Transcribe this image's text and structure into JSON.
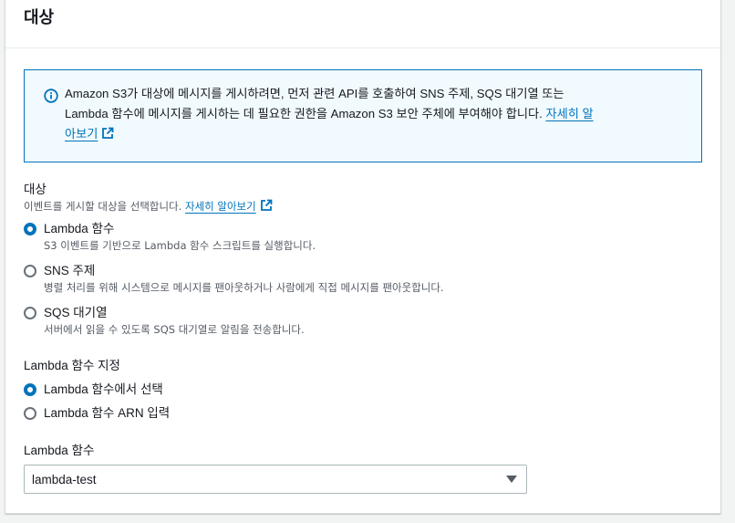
{
  "panel": {
    "title": "대상"
  },
  "alert": {
    "icon": "info-icon",
    "line1": "Amazon S3가 대상에 메시지를 게시하려면, 먼저 관련 API를 호출하여 SNS 주제, SQS 대기열 또는",
    "line2_text": "Lambda 함수에 메시지를 게시하는 데 필요한 권한을 Amazon S3 보안 주체에 부여해야 합니다. ",
    "link_part1": "자세히 알",
    "link_part2": "아보기",
    "link_icon": "external-link-icon"
  },
  "destination": {
    "label": "대상",
    "description": "이벤트를 게시할 대상을 선택합니다. ",
    "learn_more": "자세히 알아보기",
    "learn_more_icon": "external-link-icon",
    "options": [
      {
        "label": "Lambda 함수",
        "description": "S3 이벤트를 기반으로 Lambda 함수 스크립트를 실행합니다.",
        "selected": true
      },
      {
        "label": "SNS 주제",
        "description": "병렬 처리를 위해 시스템으로 메시지를 팬아웃하거나 사람에게 직접 메시지를 팬아웃합니다.",
        "selected": false
      },
      {
        "label": "SQS 대기열",
        "description": "서버에서 읽을 수 있도록 SQS 대기열로 알림을 전송합니다.",
        "selected": false
      }
    ]
  },
  "lambda_spec": {
    "label": "Lambda 함수 지정",
    "options": [
      {
        "label": "Lambda 함수에서 선택",
        "selected": true
      },
      {
        "label": "Lambda 함수 ARN 입력",
        "selected": false
      }
    ]
  },
  "lambda_function": {
    "label": "Lambda 함수",
    "value": "lambda-test"
  },
  "colors": {
    "accent": "#0073bb",
    "alert_bg": "#f1faff",
    "text": "#16191f",
    "muted": "#545b64"
  }
}
